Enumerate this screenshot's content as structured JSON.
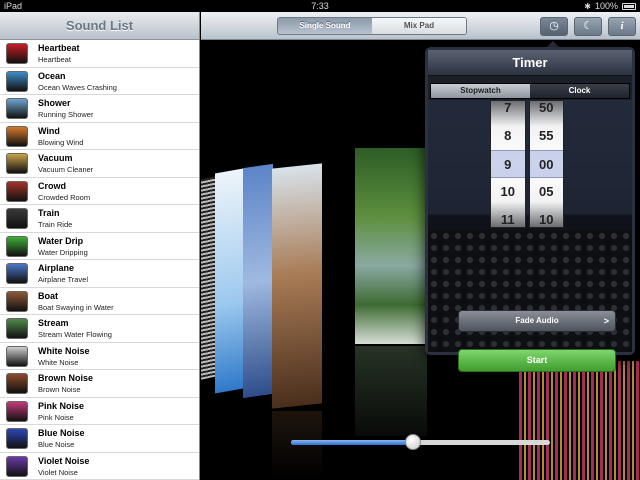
{
  "status": {
    "device": "iPad",
    "time": "7:33",
    "battery": "100%"
  },
  "sidebar": {
    "title": "Sound List",
    "items": [
      {
        "name": "Heartbeat",
        "desc": "Heartbeat",
        "color": "#c81e24"
      },
      {
        "name": "Ocean",
        "desc": "Ocean Waves Crashing",
        "color": "#3c8cc8"
      },
      {
        "name": "Shower",
        "desc": "Running Shower",
        "color": "#6fa6cf"
      },
      {
        "name": "Wind",
        "desc": "Blowing Wind",
        "color": "#d47a2a"
      },
      {
        "name": "Vacuum",
        "desc": "Vacuum Cleaner",
        "color": "#c9a24a"
      },
      {
        "name": "Crowd",
        "desc": "Crowded Room",
        "color": "#a3342a"
      },
      {
        "name": "Train",
        "desc": "Train Ride",
        "color": "#3a3a3a"
      },
      {
        "name": "Water Drip",
        "desc": "Water Dripping",
        "color": "#3fae36"
      },
      {
        "name": "Airplane",
        "desc": "Airplane Travel",
        "color": "#4a77c4"
      },
      {
        "name": "Boat",
        "desc": "Boat Swaying in Water",
        "color": "#8b5a36"
      },
      {
        "name": "Stream",
        "desc": "Stream Water Flowing",
        "color": "#4e8a4a"
      },
      {
        "name": "White Noise",
        "desc": "White Noise",
        "color": "#cfcfcf"
      },
      {
        "name": "Brown Noise",
        "desc": "Brown Noise",
        "color": "#8b4a2a"
      },
      {
        "name": "Pink Noise",
        "desc": "Pink Noise",
        "color": "#c43a7a"
      },
      {
        "name": "Blue Noise",
        "desc": "Blue Noise",
        "color": "#2e46b8"
      },
      {
        "name": "Violet Noise",
        "desc": "Violet Noise",
        "color": "#6a3aa8"
      }
    ]
  },
  "topbar": {
    "segments": [
      "Single Sound",
      "Mix Pad"
    ],
    "active_segment": "Single Sound",
    "icons": [
      "clock-icon",
      "moon-icon",
      "info-icon"
    ]
  },
  "timer": {
    "title": "Timer",
    "tabs": [
      "Stopwatch",
      "Clock"
    ],
    "active_tab": "Stopwatch",
    "hours": [
      "7",
      "8",
      "9",
      "10",
      "11"
    ],
    "minutes": [
      "50",
      "55",
      "00",
      "05",
      "10"
    ],
    "selected_hour": "9",
    "selected_minute": "00",
    "fade_label": "Fade Audio",
    "fade_arrow": ">",
    "start_label": "Start"
  },
  "volume": {
    "level": 0.47
  },
  "colors": {
    "start": "#4caf3a",
    "slider_fill": "#3e7fd9"
  }
}
